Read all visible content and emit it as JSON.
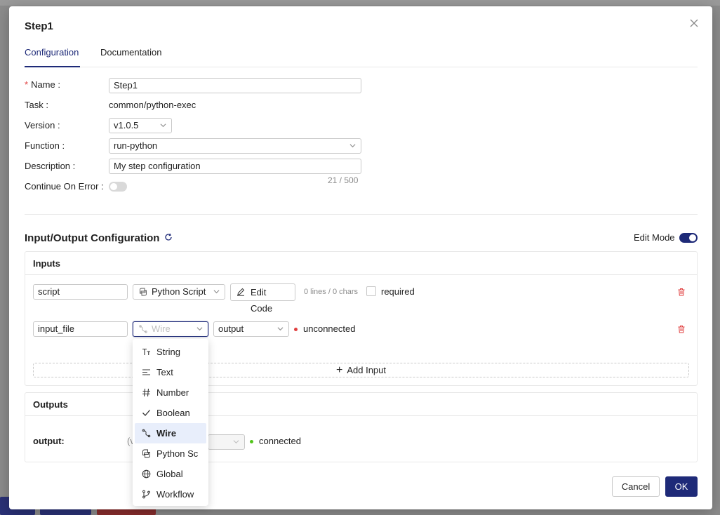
{
  "modal": {
    "title": "Step1",
    "tabs": [
      {
        "label": "Configuration",
        "active": true
      },
      {
        "label": "Documentation",
        "active": false
      }
    ]
  },
  "form": {
    "name": {
      "label": "Name",
      "value": "Step1",
      "required": true
    },
    "task": {
      "label": "Task",
      "value": "common/python-exec"
    },
    "version": {
      "label": "Version",
      "value": "v1.0.5"
    },
    "function": {
      "label": "Function",
      "value": "run-python"
    },
    "description": {
      "label": "Description",
      "value": "My step configuration",
      "counter": "21 / 500"
    },
    "continue_on_error": {
      "label": "Continue On Error",
      "enabled": false
    }
  },
  "io": {
    "title": "Input/Output Configuration",
    "edit_mode_label": "Edit Mode",
    "edit_mode_enabled": true,
    "inputs": {
      "title": "Inputs",
      "rows": [
        {
          "name": "script",
          "type": "Python Script",
          "edit_code_label": "Edit Code",
          "stats": "0 lines / 0 chars",
          "required_label": "required"
        },
        {
          "name": "input_file",
          "type_placeholder": "Wire",
          "source": "output",
          "status": "unconnected"
        }
      ],
      "add_label": "Add Input"
    },
    "outputs": {
      "title": "Outputs",
      "rows": [
        {
          "name": "output:",
          "prefix": "(v",
          "status": "connected"
        }
      ]
    }
  },
  "type_dropdown": {
    "items": [
      {
        "label": "String",
        "icon": "text-type-icon"
      },
      {
        "label": "Text",
        "icon": "align-left-icon"
      },
      {
        "label": "Number",
        "icon": "hash-icon"
      },
      {
        "label": "Boolean",
        "icon": "check-icon"
      },
      {
        "label": "Wire",
        "icon": "wire-icon",
        "selected": true
      },
      {
        "label": "Python Sc",
        "icon": "python-icon"
      },
      {
        "label": "Global",
        "icon": "globe-icon"
      },
      {
        "label": "Workflow",
        "icon": "branch-icon"
      }
    ]
  },
  "footer": {
    "cancel_label": "Cancel",
    "ok_label": "OK"
  },
  "colors": {
    "accent": "#1e2a78",
    "danger": "#e03e3e",
    "success": "#52c41a",
    "selected_bg": "#e8eefb"
  }
}
